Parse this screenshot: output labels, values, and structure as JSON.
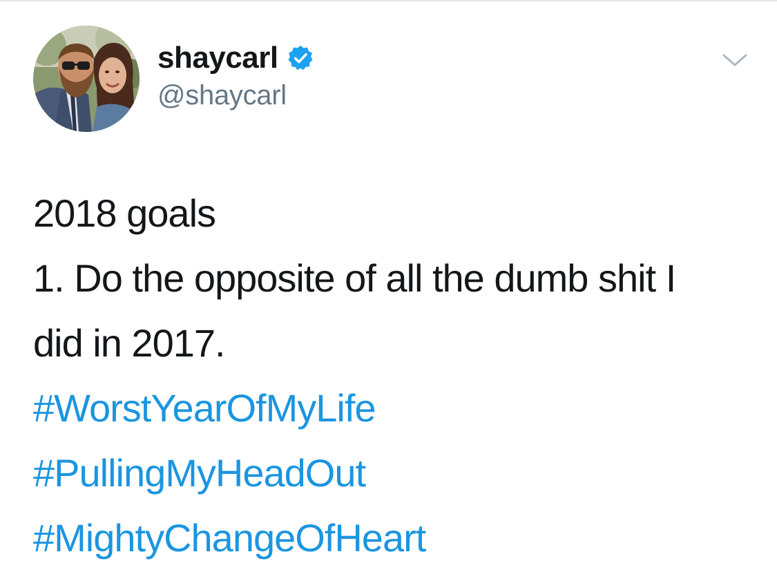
{
  "tweet": {
    "user": {
      "display_name": "shaycarl",
      "handle": "@shaycarl",
      "verified": true,
      "verified_icon": "verified-badge-icon",
      "avatar_icon": "user-avatar-photo"
    },
    "menu_icon": "chevron-down-icon",
    "text_lines": [
      "2018 goals",
      "1. Do the opposite of all the dumb shit I",
      "did in 2017."
    ],
    "hashtags": [
      "#WorstYearOfMyLife",
      "#PullingMyHeadOut",
      "#MightyChangeOfHeart"
    ]
  },
  "colors": {
    "text": "#14171a",
    "handle": "#657786",
    "hashtag": "#1b95e0",
    "verified": "#1da1f2",
    "chevron": "#aab8c2",
    "divider": "#e1e8ed"
  }
}
